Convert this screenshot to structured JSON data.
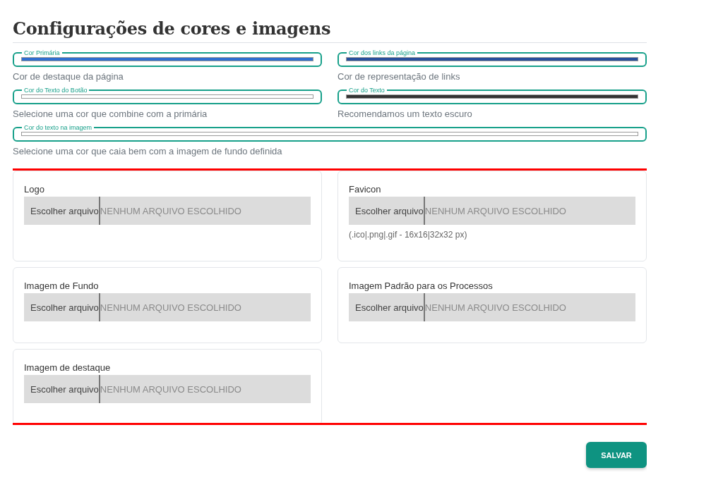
{
  "title": "Configurações de cores e imagens",
  "color_rows": [
    [
      {
        "label": "Cor Primária",
        "color": "#2f6fd0",
        "helper": "Cor de destaque da página"
      },
      {
        "label": "Cor dos links da página",
        "color": "#274f9c",
        "helper": "Cor de representação de links"
      }
    ],
    [
      {
        "label": "Cor do Texto do Botão",
        "color": "#ffffff",
        "helper": "Selecione uma cor que combine com a primária"
      },
      {
        "label": "Cor do Texto",
        "color": "#333333",
        "helper": "Recomendamos um texto escuro"
      }
    ],
    [
      {
        "label": "Cor do texto na imagem",
        "color": "#ffffff",
        "helper": "Selecione uma cor que caia bem com a imagem de fundo definida"
      }
    ]
  ],
  "uploads": [
    {
      "label": "Logo",
      "button": "Escolher arquivo",
      "status": "NENHUM ARQUIVO ESCOLHIDO"
    },
    {
      "label": "Favicon",
      "button": "Escolher arquivo",
      "status": "NENHUM ARQUIVO ESCOLHIDO",
      "hint": "(.ico|.png|.gif - 16x16|32x32 px)"
    },
    {
      "label": "Imagem de Fundo",
      "button": "Escolher arquivo",
      "status": "NENHUM ARQUIVO ESCOLHIDO"
    },
    {
      "label": "Imagem Padrão para os Processos",
      "button": "Escolher arquivo",
      "status": "NENHUM ARQUIVO ESCOLHIDO"
    },
    {
      "label": "Imagem de destaque",
      "button": "Escolher arquivo",
      "status": "NENHUM ARQUIVO ESCOLHIDO"
    }
  ],
  "save_button": "SALVAR"
}
